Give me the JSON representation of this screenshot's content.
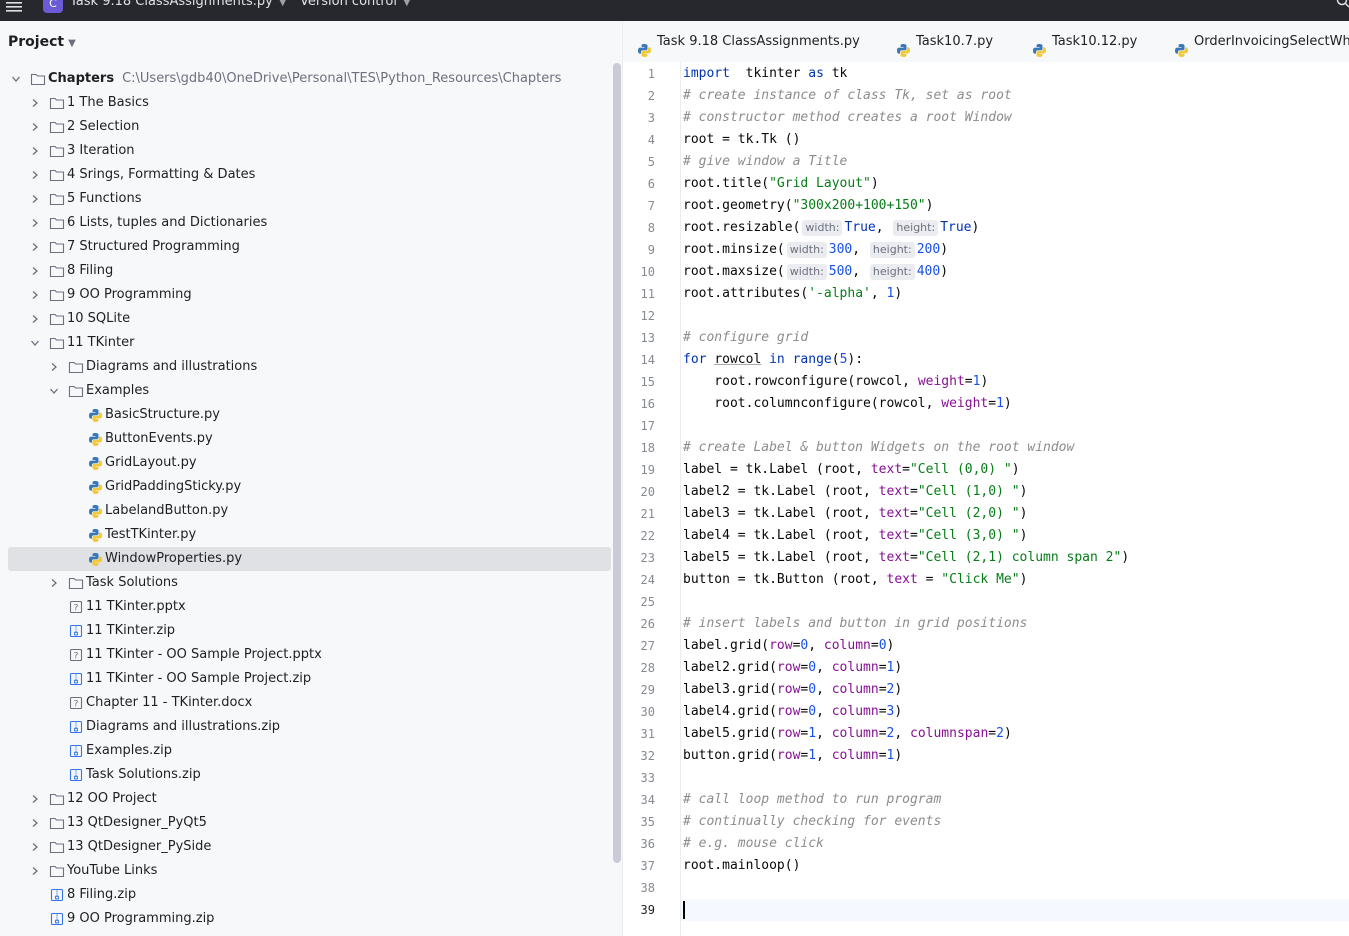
{
  "titlebar": {
    "project_badge": "C",
    "project_name": "Task 9.18 ClassAssignments.py",
    "vcs_label": "Version control"
  },
  "project_panel": {
    "title": "Project",
    "tree": [
      {
        "label": "Chapters",
        "path": "C:\\Users\\gdb40\\OneDrive\\Personal\\TES\\Python_Resources\\Chapters",
        "type": "folder",
        "depth": 0,
        "expanded": true,
        "bold": true
      },
      {
        "label": "1 The Basics",
        "type": "folder",
        "depth": 1,
        "expanded": false
      },
      {
        "label": "2 Selection",
        "type": "folder",
        "depth": 1,
        "expanded": false
      },
      {
        "label": "3 Iteration",
        "type": "folder",
        "depth": 1,
        "expanded": false
      },
      {
        "label": "4 Srings, Formatting & Dates",
        "type": "folder",
        "depth": 1,
        "expanded": false
      },
      {
        "label": "5 Functions",
        "type": "folder",
        "depth": 1,
        "expanded": false
      },
      {
        "label": "6 Lists, tuples and Dictionaries",
        "type": "folder",
        "depth": 1,
        "expanded": false
      },
      {
        "label": "7 Structured Programming",
        "type": "folder",
        "depth": 1,
        "expanded": false
      },
      {
        "label": "8 Filing",
        "type": "folder",
        "depth": 1,
        "expanded": false
      },
      {
        "label": "9 OO Programming",
        "type": "folder",
        "depth": 1,
        "expanded": false
      },
      {
        "label": "10 SQLite",
        "type": "folder",
        "depth": 1,
        "expanded": false
      },
      {
        "label": "11 TKinter",
        "type": "folder",
        "depth": 1,
        "expanded": true
      },
      {
        "label": "Diagrams and illustrations",
        "type": "folder",
        "depth": 2,
        "expanded": false
      },
      {
        "label": "Examples",
        "type": "folder",
        "depth": 2,
        "expanded": true
      },
      {
        "label": "BasicStructure.py",
        "type": "python",
        "depth": 3
      },
      {
        "label": "ButtonEvents.py",
        "type": "python",
        "depth": 3
      },
      {
        "label": "GridLayout.py",
        "type": "python",
        "depth": 3
      },
      {
        "label": "GridPaddingSticky.py",
        "type": "python",
        "depth": 3
      },
      {
        "label": "LabelandButton.py",
        "type": "python",
        "depth": 3
      },
      {
        "label": "TestTKinter.py",
        "type": "python",
        "depth": 3
      },
      {
        "label": "WindowProperties.py",
        "type": "python",
        "depth": 3,
        "selected": true
      },
      {
        "label": "Task Solutions",
        "type": "folder",
        "depth": 2,
        "expanded": false
      },
      {
        "label": "11 TKinter.pptx",
        "type": "unknown",
        "depth": 2
      },
      {
        "label": "11 TKinter.zip",
        "type": "zip",
        "depth": 2
      },
      {
        "label": "11 TKinter -  OO Sample Project.pptx",
        "type": "unknown",
        "depth": 2
      },
      {
        "label": "11 TKinter -  OO Sample Project.zip",
        "type": "zip",
        "depth": 2
      },
      {
        "label": "Chapter 11 - TKinter.docx",
        "type": "unknown",
        "depth": 2
      },
      {
        "label": "Diagrams and illustrations.zip",
        "type": "zip",
        "depth": 2
      },
      {
        "label": "Examples.zip",
        "type": "zip",
        "depth": 2
      },
      {
        "label": "Task Solutions.zip",
        "type": "zip",
        "depth": 2
      },
      {
        "label": "12 OO Project",
        "type": "folder",
        "depth": 1,
        "expanded": false
      },
      {
        "label": "13 QtDesigner_PyQt5",
        "type": "folder",
        "depth": 1,
        "expanded": false
      },
      {
        "label": "13 QtDesigner_PySide",
        "type": "folder",
        "depth": 1,
        "expanded": false
      },
      {
        "label": "YouTube Links",
        "type": "folder",
        "depth": 1,
        "expanded": false
      },
      {
        "label": "8 Filing.zip",
        "type": "zip",
        "depth": 1
      },
      {
        "label": "9 OO Programming.zip",
        "type": "zip",
        "depth": 1
      }
    ]
  },
  "tabs": [
    {
      "label": "Task 9.18 ClassAssignments.py"
    },
    {
      "label": "Task10.7.py"
    },
    {
      "label": "Task10.12.py"
    },
    {
      "label": "OrderInvoicingSelectWhere.py"
    }
  ],
  "editor": {
    "current_line": 39,
    "lines": [
      [
        [
          "kw",
          "import"
        ],
        [
          "",
          "  tkinter "
        ],
        [
          "kw",
          "as"
        ],
        [
          "",
          " tk"
        ]
      ],
      [
        [
          "cm",
          "# create instance of class Tk, set as root"
        ]
      ],
      [
        [
          "cm",
          "# constructor method creates a root Window"
        ]
      ],
      [
        [
          "",
          "root = tk.Tk ()"
        ]
      ],
      [
        [
          "cm",
          "# give window a Title"
        ]
      ],
      [
        [
          "",
          "root.title("
        ],
        [
          "str",
          "\"Grid Layout\""
        ],
        [
          "",
          ")"
        ]
      ],
      [
        [
          "",
          "root.geometry("
        ],
        [
          "str",
          "\"300x200+100+150\""
        ],
        [
          "",
          ")"
        ]
      ],
      [
        [
          "",
          "root.resizable("
        ],
        [
          "hint",
          "width:"
        ],
        [
          "kw",
          "True"
        ],
        [
          "",
          ", "
        ],
        [
          "hint",
          "height:"
        ],
        [
          "kw",
          "True"
        ],
        [
          "",
          ")"
        ]
      ],
      [
        [
          "",
          "root.minsize("
        ],
        [
          "hint",
          "width:"
        ],
        [
          "num",
          "300"
        ],
        [
          "",
          ", "
        ],
        [
          "hint",
          "height:"
        ],
        [
          "num",
          "200"
        ],
        [
          "",
          ")"
        ]
      ],
      [
        [
          "",
          "root.maxsize("
        ],
        [
          "hint",
          "width:"
        ],
        [
          "num",
          "500"
        ],
        [
          "",
          ", "
        ],
        [
          "hint",
          "height:"
        ],
        [
          "num",
          "400"
        ],
        [
          "",
          ")"
        ]
      ],
      [
        [
          "",
          "root.attributes("
        ],
        [
          "str",
          "'-alpha'"
        ],
        [
          "",
          ", "
        ],
        [
          "num",
          "1"
        ],
        [
          "",
          ")"
        ]
      ],
      [],
      [
        [
          "cm",
          "# configure grid"
        ]
      ],
      [
        [
          "kw",
          "for"
        ],
        [
          "",
          " "
        ],
        [
          "ul",
          "rowcol"
        ],
        [
          "",
          " "
        ],
        [
          "kw",
          "in"
        ],
        [
          "",
          " "
        ],
        [
          "kw",
          "range"
        ],
        [
          "",
          "("
        ],
        [
          "num",
          "5"
        ],
        [
          "",
          "):"
        ]
      ],
      [
        [
          "",
          "    root.rowconfigure(rowcol, "
        ],
        [
          "kwarg",
          "weight"
        ],
        [
          "",
          "="
        ],
        [
          "num",
          "1"
        ],
        [
          "",
          ")"
        ]
      ],
      [
        [
          "",
          "    root.columnconfigure(rowcol, "
        ],
        [
          "kwarg",
          "weight"
        ],
        [
          "",
          "="
        ],
        [
          "num",
          "1"
        ],
        [
          "",
          ")"
        ]
      ],
      [],
      [
        [
          "cm",
          "# create Label & button Widgets on the root window"
        ]
      ],
      [
        [
          "",
          "label = tk.Label (root, "
        ],
        [
          "kwarg",
          "text"
        ],
        [
          "",
          "="
        ],
        [
          "str",
          "\"Cell (0,0) \""
        ],
        [
          "",
          ")"
        ]
      ],
      [
        [
          "",
          "label2 = tk.Label (root, "
        ],
        [
          "kwarg",
          "text"
        ],
        [
          "",
          "="
        ],
        [
          "str",
          "\"Cell (1,0) \""
        ],
        [
          "",
          ")"
        ]
      ],
      [
        [
          "",
          "label3 = tk.Label (root, "
        ],
        [
          "kwarg",
          "text"
        ],
        [
          "",
          "="
        ],
        [
          "str",
          "\"Cell (2,0) \""
        ],
        [
          "",
          ")"
        ]
      ],
      [
        [
          "",
          "label4 = tk.Label (root, "
        ],
        [
          "kwarg",
          "text"
        ],
        [
          "",
          "="
        ],
        [
          "str",
          "\"Cell (3,0) \""
        ],
        [
          "",
          ")"
        ]
      ],
      [
        [
          "",
          "label5 = tk.Label (root, "
        ],
        [
          "kwarg",
          "text"
        ],
        [
          "",
          "="
        ],
        [
          "str",
          "\"Cell (2,1) column span 2\""
        ],
        [
          "",
          ")"
        ]
      ],
      [
        [
          "",
          "button = tk.Button (root, "
        ],
        [
          "kwarg",
          "text"
        ],
        [
          "",
          " = "
        ],
        [
          "str",
          "\"Click Me\""
        ],
        [
          "",
          ")"
        ]
      ],
      [],
      [
        [
          "cm",
          "# insert labels and button in grid positions"
        ]
      ],
      [
        [
          "",
          "label.grid("
        ],
        [
          "kwarg",
          "row"
        ],
        [
          "",
          "="
        ],
        [
          "num",
          "0"
        ],
        [
          "",
          ", "
        ],
        [
          "kwarg",
          "column"
        ],
        [
          "",
          "="
        ],
        [
          "num",
          "0"
        ],
        [
          "",
          ")"
        ]
      ],
      [
        [
          "",
          "label2.grid("
        ],
        [
          "kwarg",
          "row"
        ],
        [
          "",
          "="
        ],
        [
          "num",
          "0"
        ],
        [
          "",
          ", "
        ],
        [
          "kwarg",
          "column"
        ],
        [
          "",
          "="
        ],
        [
          "num",
          "1"
        ],
        [
          "",
          ")"
        ]
      ],
      [
        [
          "",
          "label3.grid("
        ],
        [
          "kwarg",
          "row"
        ],
        [
          "",
          "="
        ],
        [
          "num",
          "0"
        ],
        [
          "",
          ", "
        ],
        [
          "kwarg",
          "column"
        ],
        [
          "",
          "="
        ],
        [
          "num",
          "2"
        ],
        [
          "",
          ")"
        ]
      ],
      [
        [
          "",
          "label4.grid("
        ],
        [
          "kwarg",
          "row"
        ],
        [
          "",
          "="
        ],
        [
          "num",
          "0"
        ],
        [
          "",
          ", "
        ],
        [
          "kwarg",
          "column"
        ],
        [
          "",
          "="
        ],
        [
          "num",
          "3"
        ],
        [
          "",
          ")"
        ]
      ],
      [
        [
          "",
          "label5.grid("
        ],
        [
          "kwarg",
          "row"
        ],
        [
          "",
          "="
        ],
        [
          "num",
          "1"
        ],
        [
          "",
          ", "
        ],
        [
          "kwarg",
          "column"
        ],
        [
          "",
          "="
        ],
        [
          "num",
          "2"
        ],
        [
          "",
          ", "
        ],
        [
          "kwarg",
          "columnspan"
        ],
        [
          "",
          "="
        ],
        [
          "num",
          "2"
        ],
        [
          "",
          ")"
        ]
      ],
      [
        [
          "",
          "button.grid("
        ],
        [
          "kwarg",
          "row"
        ],
        [
          "",
          "="
        ],
        [
          "num",
          "1"
        ],
        [
          "",
          ", "
        ],
        [
          "kwarg",
          "column"
        ],
        [
          "",
          "="
        ],
        [
          "num",
          "1"
        ],
        [
          "",
          ")"
        ]
      ],
      [],
      [
        [
          "cm",
          "# call loop method to run program"
        ]
      ],
      [
        [
          "cm",
          "# continually checking for events"
        ]
      ],
      [
        [
          "cm",
          "# e.g. mouse click"
        ]
      ],
      [
        [
          "",
          "root.mainloop()"
        ]
      ],
      [],
      []
    ]
  },
  "colors": {
    "titlebar_bg": "#27282e",
    "panel_bg": "#f7f8fa",
    "selection_bg": "#dfe1e5",
    "keyword": "#0033b3",
    "string": "#067d17",
    "number": "#1750eb",
    "comment": "#8c8c8c",
    "kwarg": "#871094"
  },
  "icons": {
    "menu": "hamburger-menu-icon",
    "folder": "folder-icon",
    "python_file": "python-file-icon",
    "zip_file": "zip-file-icon",
    "unknown_file": "unknown-file-icon",
    "expand": "chevron-right-icon",
    "collapse": "chevron-down-icon",
    "search": "search-icon"
  }
}
